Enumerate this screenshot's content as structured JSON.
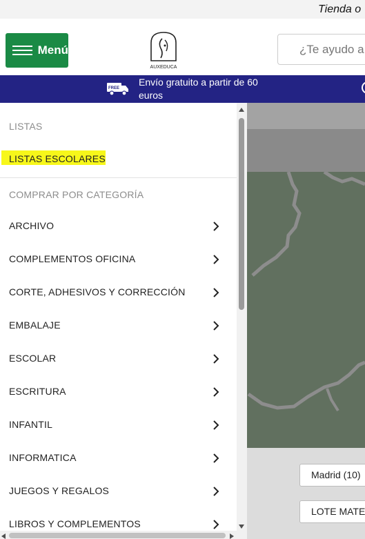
{
  "topbar": {
    "tagline": "Tienda o"
  },
  "header": {
    "menu_label": "Menú",
    "logo_text": "AUXEDUCA",
    "search_placeholder": "¿Te ayudo a"
  },
  "promo": {
    "truck_badge": "FREE",
    "text": "Envío gratuito a partir de 60 euros",
    "chat_icon": "whatsapp-icon"
  },
  "drawer": {
    "section_lists": "LISTAS",
    "school_lists": "LISTAS ESCOLARES",
    "section_categories": "COMPRAR POR CATEGORÍA",
    "categories": [
      {
        "label": "ARCHIVO"
      },
      {
        "label": "COMPLEMENTOS OFICINA"
      },
      {
        "label": "CORTE, ADHESIVOS Y CORRECCIÓN"
      },
      {
        "label": "EMBALAJE"
      },
      {
        "label": "ESCOLAR"
      },
      {
        "label": "ESCRITURA"
      },
      {
        "label": "INFANTIL"
      },
      {
        "label": "INFORMATICA"
      },
      {
        "label": "JUEGOS Y REGALOS"
      },
      {
        "label": "LIBROS Y COMPLEMENTOS"
      }
    ],
    "chevron_icon": "chevron-right-icon"
  },
  "background": {
    "chip_madrid": "Madrid (10)",
    "chip_lote": "LOTE MATE"
  },
  "colors": {
    "menu_green": "#1a8a45",
    "promo_blue": "#232384",
    "highlight_yellow": "#f7f71a",
    "map_green": "#61705f"
  }
}
